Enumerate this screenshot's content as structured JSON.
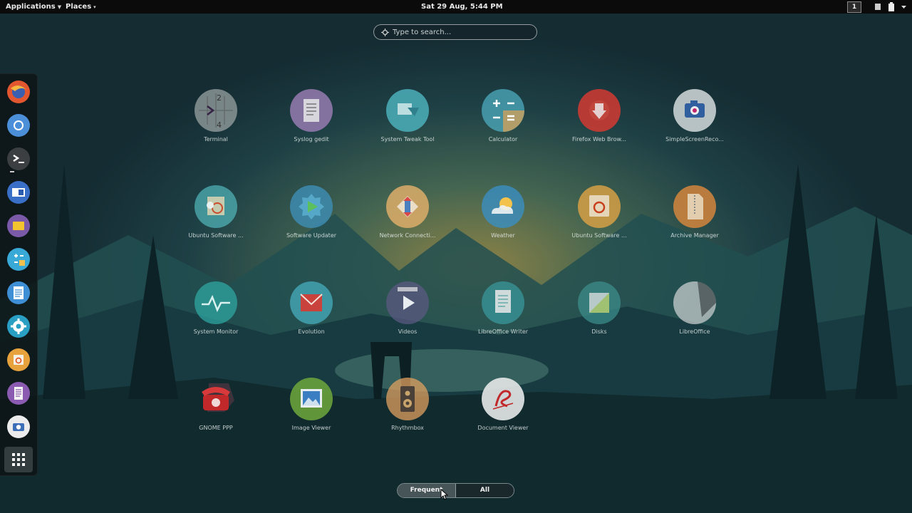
{
  "topbar": {
    "applications": "Applications",
    "places": "Places",
    "clock": "Sat 29 Aug,  5:44 PM",
    "workspace": "1"
  },
  "search": {
    "placeholder": "Type to search..."
  },
  "dash": [
    {
      "name": "firefox",
      "icon": "firefox-icon",
      "color": "#e2572f"
    },
    {
      "name": "chromium",
      "icon": "chromium-icon",
      "color": "#4c8fd9"
    },
    {
      "name": "terminal",
      "icon": "terminal-icon",
      "color": "#2e3436"
    },
    {
      "name": "remmina",
      "icon": "remote-desktop-icon",
      "color": "#3a6fc8"
    },
    {
      "name": "files",
      "icon": "folder-icon",
      "color": "#7a5aa8"
    },
    {
      "name": "calculator",
      "icon": "calculator-icon",
      "color": "#39a9d8"
    },
    {
      "name": "writer",
      "icon": "document-icon",
      "color": "#3e8fd6"
    },
    {
      "name": "settings",
      "icon": "gear-icon",
      "color": "#2a9fc4"
    },
    {
      "name": "software",
      "icon": "software-center-icon",
      "color": "#e8a23d"
    },
    {
      "name": "text-editor",
      "icon": "text-editor-icon",
      "color": "#8a5bb0"
    },
    {
      "name": "screenshot",
      "icon": "camera-icon",
      "color": "#e8e8e8"
    }
  ],
  "apps": [
    {
      "label": "Terminal",
      "icon": "terminal-grid-icon"
    },
    {
      "label": "Syslog gedit",
      "icon": "text-editor-icon"
    },
    {
      "label": "System Tweak Tool",
      "icon": "tweak-tool-icon"
    },
    {
      "label": "Calculator",
      "icon": "calculator-icon"
    },
    {
      "label": "Firefox Web Brow...",
      "icon": "firefox-icon"
    },
    {
      "label": "SimpleScreenReco...",
      "icon": "camera-icon"
    },
    {
      "label": "Ubuntu Software ...",
      "icon": "weather-icon"
    },
    {
      "label": "Software Updater",
      "icon": "software-updater-icon"
    },
    {
      "label": "Network Connecti...",
      "icon": "network-icon"
    },
    {
      "label": "Weather",
      "icon": "weather-icon"
    },
    {
      "label": "Ubuntu Software ...",
      "icon": "software-center-icon"
    },
    {
      "label": "Archive Manager",
      "icon": "archive-icon"
    },
    {
      "label": "System Monitor",
      "icon": "system-monitor-icon"
    },
    {
      "label": "Evolution",
      "icon": "mail-icon"
    },
    {
      "label": "Videos",
      "icon": "video-icon"
    },
    {
      "label": "LibreOffice Writer",
      "icon": "document-icon"
    },
    {
      "label": "Disks",
      "icon": "disks-icon"
    },
    {
      "label": "LibreOffice",
      "icon": "libreoffice-icon"
    },
    {
      "label": "GNOME PPP",
      "icon": "telephone-icon"
    },
    {
      "label": "Image Viewer",
      "icon": "image-icon"
    },
    {
      "label": "Rhythmbox",
      "icon": "speaker-icon"
    },
    {
      "label": "Document Viewer",
      "icon": "document-viewer-icon"
    }
  ],
  "switcher": {
    "frequent": "Frequent",
    "all": "All"
  }
}
